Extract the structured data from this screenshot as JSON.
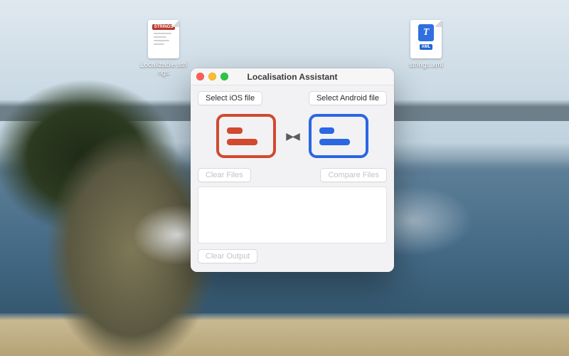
{
  "desktop": {
    "icons": [
      {
        "label": "Localizable.strings",
        "badge": "STRINGS"
      },
      {
        "label": "strings.xml",
        "badge": "XML"
      }
    ]
  },
  "window": {
    "title": "Localisation Assistant",
    "buttons": {
      "select_ios": "Select iOS file",
      "select_android": "Select Android file",
      "clear_files": "Clear Files",
      "compare_files": "Compare Files",
      "clear_output": "Clear Output"
    }
  },
  "colors": {
    "ios_accent": "#d1492f",
    "android_accent": "#2b66e3"
  }
}
